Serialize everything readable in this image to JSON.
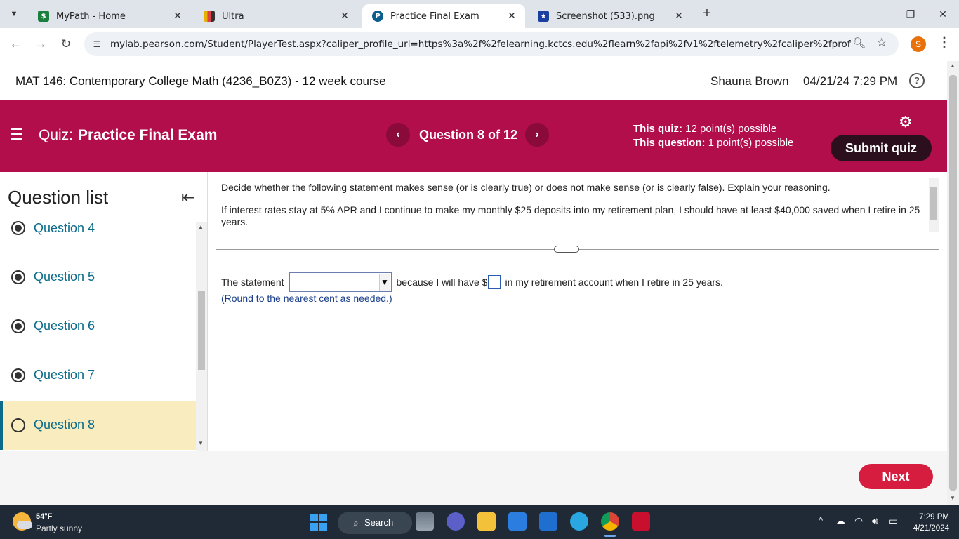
{
  "browser": {
    "tabs": [
      {
        "title": "MyPath - Home",
        "active": false
      },
      {
        "title": "Ultra",
        "active": false
      },
      {
        "title": "Practice Final Exam",
        "active": true
      },
      {
        "title": "Screenshot (533).png",
        "active": false
      }
    ],
    "url": "mylab.pearson.com/Student/PlayerTest.aspx?caliper_profile_url=https%3a%2f%2felearning.kctcs.edu%2flearn%2fapi%2fv1%2ftelemetry%2fcaliper%2fprofile%2f_5313268...",
    "profile_initial": "S"
  },
  "course": {
    "title": "MAT 146: Contemporary College Math (4236_B0Z3) - 12 week course",
    "user": "Shauna Brown",
    "datetime": "04/21/24 7:29 PM"
  },
  "quiz": {
    "label": "Quiz:",
    "name": "Practice Final Exam",
    "position": "Question 8 of 12",
    "quiz_points_label": "This quiz:",
    "quiz_points": "12 point(s) possible",
    "question_points_label": "This question:",
    "question_points": "1 point(s) possible",
    "submit_label": "Submit quiz"
  },
  "question_list": {
    "heading": "Question list",
    "items": [
      {
        "label": "Question 4",
        "answered": true
      },
      {
        "label": "Question 5",
        "answered": true
      },
      {
        "label": "Question 6",
        "answered": true
      },
      {
        "label": "Question 7",
        "answered": true
      },
      {
        "label": "Question 8",
        "answered": false,
        "current": true
      }
    ]
  },
  "question": {
    "instruction": "Decide whether the following statement makes sense (or is clearly true) or does not make sense (or is clearly false). Explain your reasoning.",
    "statement": "If interest rates stay at 5% APR and I continue to make my monthly $25 deposits into my retirement plan, I should have at least $40,000 saved when I retire in 25 years.",
    "answer_prefix": "The statement",
    "answer_middle": "because I will have $",
    "answer_suffix": "in my retirement account when I retire in 25 years.",
    "round_note": "(Round to the nearest cent as needed.)",
    "select_value": "",
    "amount_value": ""
  },
  "footer": {
    "next_label": "Next"
  },
  "taskbar": {
    "temperature": "54°F",
    "weather": "Partly sunny",
    "search_label": "Search",
    "time": "7:29 PM",
    "date": "4/21/2024"
  },
  "colors": {
    "banner": "#b10e4b",
    "submit": "#2c0f1c",
    "next": "#d61c3f",
    "current_question_bg": "#f9ecbf",
    "link": "#0a6b8a"
  }
}
